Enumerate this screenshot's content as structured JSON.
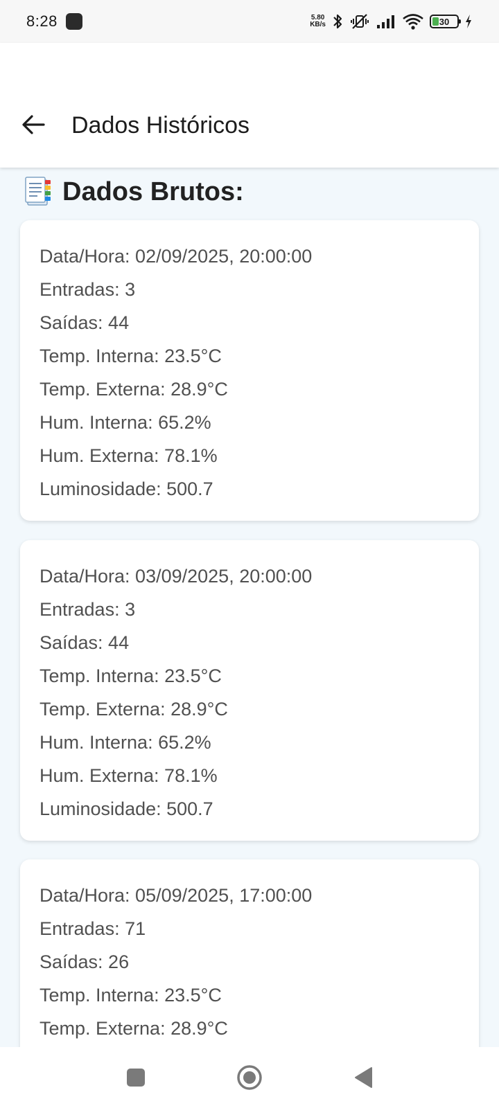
{
  "status_bar": {
    "time": "8:28",
    "net_speed_value": "5.80",
    "net_speed_unit": "KB/s",
    "battery_level": "30",
    "icons": [
      "app-notification-icon",
      "bluetooth-icon",
      "vibrate-off-icon",
      "signal-icon",
      "wifi-icon",
      "battery-icon",
      "charging-icon"
    ]
  },
  "app_bar": {
    "title": "Dados Históricos",
    "back_icon": "arrow-left-icon"
  },
  "section": {
    "title": "Dados Brutos:",
    "icon": "notepad-icon"
  },
  "records": [
    {
      "datetime": "Data/Hora: 02/09/2025, 20:00:00",
      "entradas": "Entradas: 3",
      "saidas": "Saídas: 44",
      "temp_interna": "Temp. Interna: 23.5°C",
      "temp_externa": "Temp. Externa: 28.9°C",
      "hum_interna": "Hum. Interna: 65.2%",
      "hum_externa": "Hum. Externa: 78.1%",
      "luminosidade": "Luminosidade: 500.7"
    },
    {
      "datetime": "Data/Hora: 03/09/2025, 20:00:00",
      "entradas": "Entradas: 3",
      "saidas": "Saídas: 44",
      "temp_interna": "Temp. Interna: 23.5°C",
      "temp_externa": "Temp. Externa: 28.9°C",
      "hum_interna": "Hum. Interna: 65.2%",
      "hum_externa": "Hum. Externa: 78.1%",
      "luminosidade": "Luminosidade: 500.7"
    },
    {
      "datetime": "Data/Hora: 05/09/2025, 17:00:00",
      "entradas": "Entradas: 71",
      "saidas": "Saídas: 26",
      "temp_interna": "Temp. Interna: 23.5°C",
      "temp_externa": "Temp. Externa: 28.9°C"
    }
  ],
  "nav_bar": {
    "icons": [
      "recents-square-icon",
      "home-circle-icon",
      "back-triangle-icon"
    ]
  },
  "colors": {
    "background": "#f2f8fc",
    "card": "#ffffff",
    "text_secondary": "#505050",
    "title": "#222222",
    "battery_fill": "#4caf50"
  }
}
